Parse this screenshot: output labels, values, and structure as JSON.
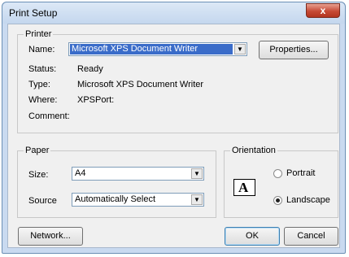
{
  "window": {
    "title": "Print Setup",
    "close_label": "x"
  },
  "printer": {
    "group_label": "Printer",
    "name_label": "Name:",
    "name_value": "Microsoft XPS Document Writer",
    "properties_button": "Properties...",
    "status_label": "Status:",
    "status_value": "Ready",
    "type_label": "Type:",
    "type_value": "Microsoft XPS Document Writer",
    "where_label": "Where:",
    "where_value": "XPSPort:",
    "comment_label": "Comment:"
  },
  "paper": {
    "group_label": "Paper",
    "size_label": "Size:",
    "size_value": "A4",
    "source_label": "Source",
    "source_value": "Automatically Select"
  },
  "orientation": {
    "group_label": "Orientation",
    "preview_letter": "A",
    "portrait_label": "Portrait",
    "landscape_label": "Landscape",
    "selected": "Landscape"
  },
  "buttons": {
    "network": "Network...",
    "ok": "OK",
    "cancel": "Cancel"
  }
}
